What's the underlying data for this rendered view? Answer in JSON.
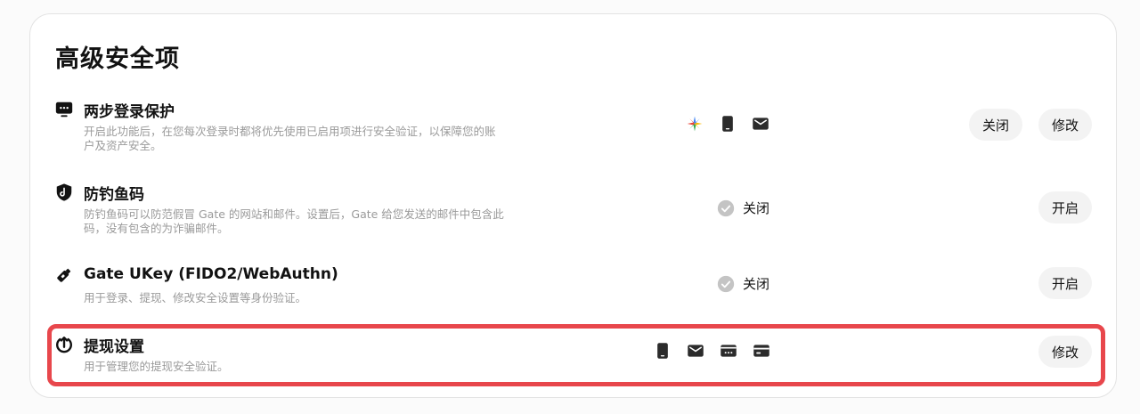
{
  "title": "高级安全项",
  "rows": [
    {
      "icon": "monitor-chat-icon",
      "title": "两步登录保护",
      "desc_line1": "开启此功能后，在您每次登录时都将优先使用已启用项进行安全验证，以保障您的账",
      "desc_line2": "户及资产安全。",
      "methods": [
        "google-authenticator-icon",
        "phone-icon",
        "email-icon"
      ],
      "buttons": [
        "关闭",
        "修改"
      ]
    },
    {
      "icon": "anti-phishing-shield-icon",
      "title": "防钓鱼码",
      "desc_line1": "防钓鱼码可以防范假冒 Gate 的网站和邮件。设置后，Gate 给您发送的邮件中包含此",
      "desc_line2": "码，没有包含的为诈骗邮件。",
      "status": "关闭",
      "buttons": [
        "开启"
      ]
    },
    {
      "icon": "ukey-icon",
      "title": "Gate UKey (FIDO2/WebAuthn)",
      "desc_line1": "用于登录、提现、修改安全设置等身份验证。",
      "status": "关闭",
      "buttons": [
        "开启"
      ]
    },
    {
      "icon": "withdraw-icon",
      "title": "提现设置",
      "desc_line1": "用于管理您的提现安全验证。",
      "methods": [
        "phone-icon",
        "email-icon",
        "fund-password-icon",
        "card-icon"
      ],
      "buttons": [
        "修改"
      ]
    }
  ],
  "colors": {
    "highlight_border": "#e8474c",
    "pill_bg": "#f3f3f3",
    "muted_text": "#9a9a9a"
  }
}
